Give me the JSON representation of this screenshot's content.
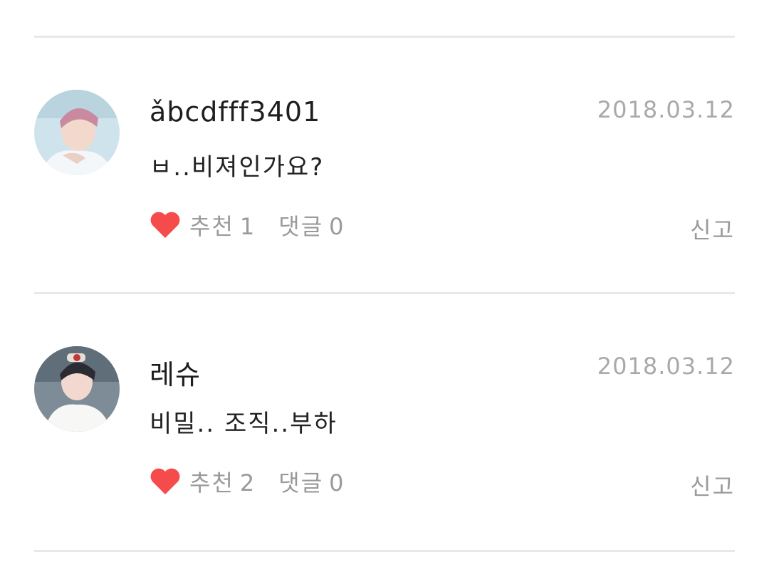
{
  "comments": [
    {
      "username": "ǎbcdfff3401",
      "date": "2018.03.12",
      "text": "ㅂ..비져인가요?",
      "like_label": "추천",
      "like_count": "1",
      "reply_label": "댓글",
      "reply_count": "0",
      "report_label": "신고",
      "avatar": "avatar-photo"
    },
    {
      "username": "레슈",
      "date": "2018.03.12",
      "text": "비밀.. 조직..부하",
      "like_label": "추천",
      "like_count": "2",
      "reply_label": "댓글",
      "reply_count": "0",
      "report_label": "신고",
      "avatar": "avatar-photo"
    }
  ],
  "colors": {
    "heart": "#f54b4b",
    "muted_text": "#9a9a9a",
    "date_text": "#a9a9a9",
    "divider": "#e8e8e8"
  }
}
